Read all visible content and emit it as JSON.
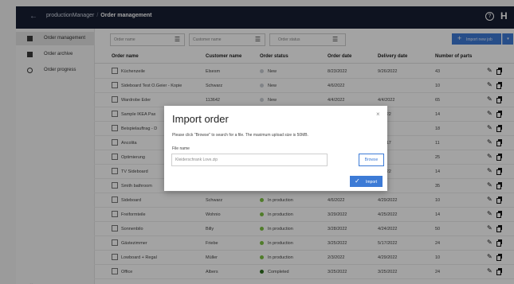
{
  "topbar": {
    "app_name": "productionManager",
    "separator": "/",
    "current_page": "Order management",
    "brand": "H"
  },
  "sidebar": {
    "items": [
      {
        "label": "Order management",
        "icon": "grid-icon"
      },
      {
        "label": "Order archive",
        "icon": "archive-icon"
      },
      {
        "label": "Order progress",
        "icon": "progress-icon"
      }
    ],
    "collapse_glyph": "«"
  },
  "toolbar": {
    "filters": [
      {
        "placeholder": "Order name"
      },
      {
        "placeholder": "Customer name"
      },
      {
        "placeholder": "Order status"
      }
    ],
    "import_label": "Import new job"
  },
  "table": {
    "columns": [
      "Order name",
      "Customer name",
      "Order status",
      "Order date",
      "Delivery date",
      "Number of parts"
    ],
    "rows": [
      {
        "name": "Küchenzeile",
        "customer": "Elsesm",
        "status": "New",
        "status_color": "#c8cdd3",
        "order_date": "8/23/2022",
        "delivery_date": "9/26/2022",
        "parts": "43"
      },
      {
        "name": "Sideboard Test O.Geier - Kopie",
        "customer": "Schwarz",
        "status": "New",
        "status_color": "#c8cdd3",
        "order_date": "4/6/2022",
        "delivery_date": "",
        "parts": "10"
      },
      {
        "name": "Wardrobe Eder",
        "customer": "113642",
        "status": "New",
        "status_color": "#c8cdd3",
        "order_date": "4/4/2022",
        "delivery_date": "4/4/2022",
        "parts": "65"
      },
      {
        "name": "Sample IKEA Pax",
        "customer": "",
        "status": "",
        "status_color": "",
        "order_date": "",
        "delivery_date": "5/2022",
        "parts": "14"
      },
      {
        "name": "Beispielauftrag - D",
        "customer": "",
        "status": "",
        "status_color": "",
        "order_date": "",
        "delivery_date": "",
        "parts": "18"
      },
      {
        "name": "Ancolita",
        "customer": "",
        "status": "",
        "status_color": "",
        "order_date": "",
        "delivery_date": "2/2017",
        "parts": "11"
      },
      {
        "name": "Optimierung",
        "customer": "",
        "status": "",
        "status_color": "",
        "order_date": "",
        "delivery_date": "",
        "parts": "25"
      },
      {
        "name": "TV Sideboard",
        "customer": "",
        "status": "",
        "status_color": "",
        "order_date": "",
        "delivery_date": "8/2022",
        "parts": "14"
      },
      {
        "name": "Smith bathroom",
        "customer": "",
        "status": "",
        "status_color": "",
        "order_date": "",
        "delivery_date": "2022",
        "parts": "35"
      },
      {
        "name": "Sideboard",
        "customer": "Schwarz",
        "status": "In production",
        "status_color": "#7ec242",
        "order_date": "4/6/2022",
        "delivery_date": "4/29/2022",
        "parts": "10"
      },
      {
        "name": "Freiformteile",
        "customer": "Wohnio",
        "status": "In production",
        "status_color": "#7ec242",
        "order_date": "3/29/2022",
        "delivery_date": "4/25/2022",
        "parts": "14"
      },
      {
        "name": "Sonnenbilo",
        "customer": "Billy",
        "status": "In production",
        "status_color": "#7ec242",
        "order_date": "3/28/2022",
        "delivery_date": "4/24/2022",
        "parts": "50"
      },
      {
        "name": "Gästezimmer",
        "customer": "Friebe",
        "status": "In production",
        "status_color": "#7ec242",
        "order_date": "3/25/2022",
        "delivery_date": "5/17/2022",
        "parts": "24"
      },
      {
        "name": "Lowboard + Regal",
        "customer": "Müller",
        "status": "In production",
        "status_color": "#7ec242",
        "order_date": "2/3/2022",
        "delivery_date": "4/29/2022",
        "parts": "10"
      },
      {
        "name": "Office",
        "customer": "Albers",
        "status": "Completed",
        "status_color": "#2e6e1e",
        "order_date": "3/25/2022",
        "delivery_date": "3/25/2022",
        "parts": "24"
      }
    ]
  },
  "modal": {
    "title": "Import order",
    "close_glyph": "×",
    "description": "Please click \"Browse\" to search for a file. The maximum upload size is 50MB.",
    "file_label": "File name",
    "file_value": "Kleiderschrank Love.zip",
    "browse_label": "Browse",
    "import_label": "Import"
  }
}
